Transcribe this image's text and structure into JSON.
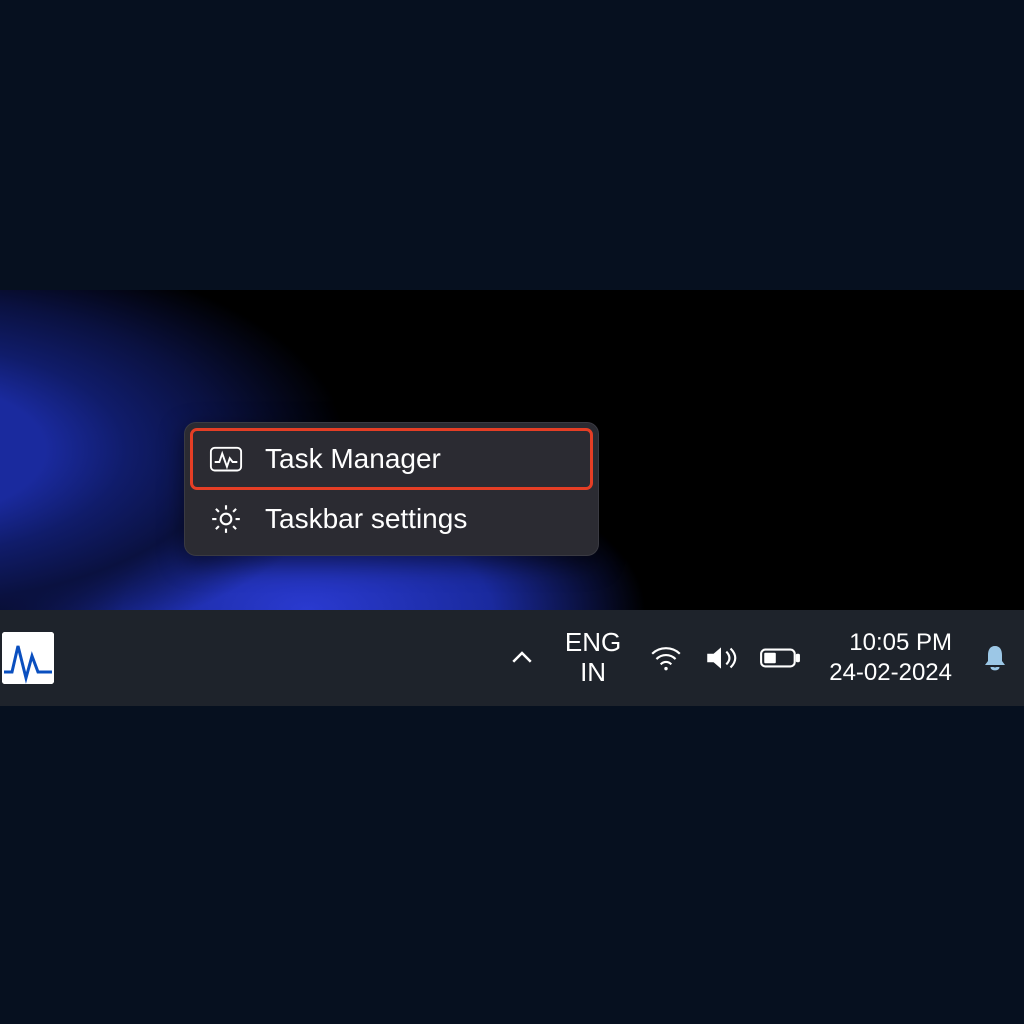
{
  "colors": {
    "highlight": "#e53e25",
    "taskbar": "#1e232b",
    "menu_bg": "#2b2b32"
  },
  "context_menu": {
    "items": [
      {
        "label": "Task Manager",
        "icon": "pulse-monitor-icon",
        "highlighted": true
      },
      {
        "label": "Taskbar settings",
        "icon": "gear-icon",
        "highlighted": false
      }
    ]
  },
  "taskbar": {
    "pinned_app": {
      "name": "task-manager-app",
      "active": true
    },
    "overflow_chevron": "^",
    "language": {
      "line1": "ENG",
      "line2": "IN"
    },
    "tray": {
      "wifi": "wifi-icon",
      "volume": "volume-icon",
      "battery": "battery-icon"
    },
    "clock": {
      "time": "10:05 PM",
      "date": "24-02-2024"
    },
    "notifications": "bell-icon"
  }
}
